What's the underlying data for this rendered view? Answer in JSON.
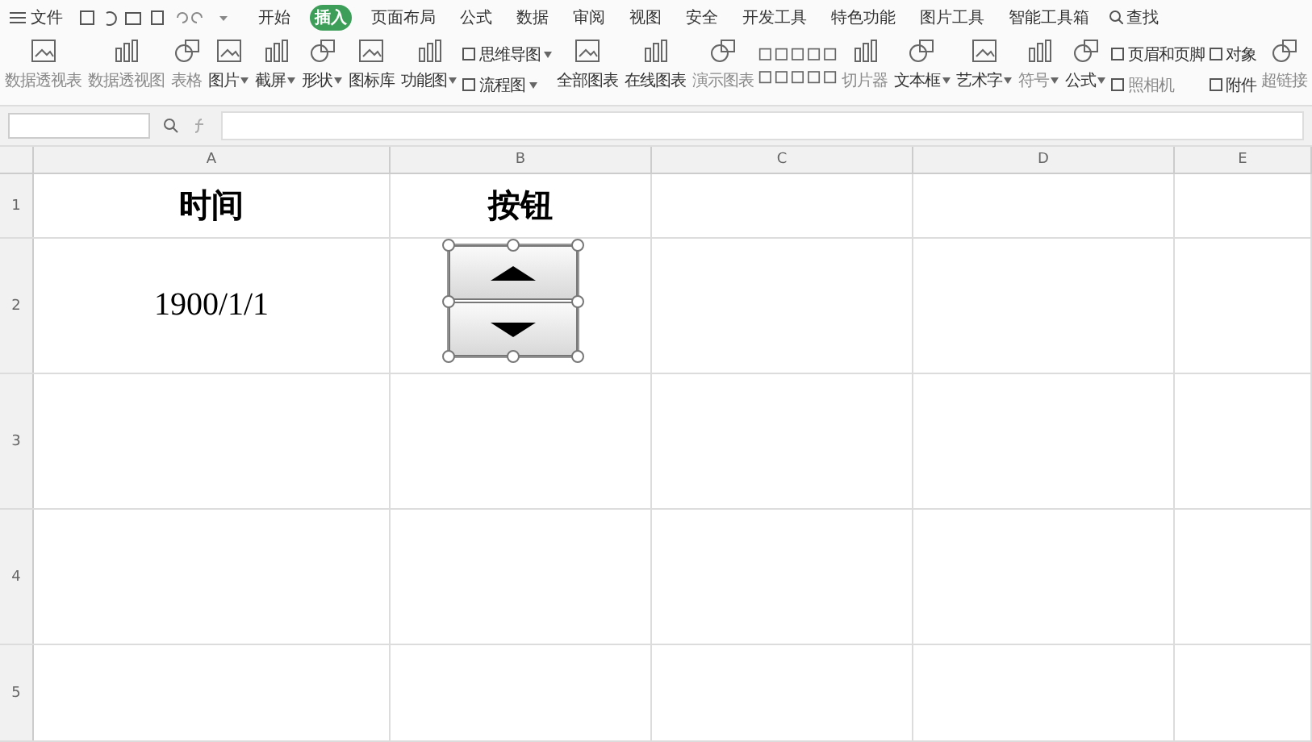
{
  "menu": {
    "file": "文件",
    "tabs": [
      {
        "label": "开始",
        "selected": false
      },
      {
        "label": "插入",
        "selected": true
      },
      {
        "label": "页面布局",
        "selected": false
      },
      {
        "label": "公式",
        "selected": false
      },
      {
        "label": "数据",
        "selected": false
      },
      {
        "label": "审阅",
        "selected": false
      },
      {
        "label": "视图",
        "selected": false
      },
      {
        "label": "安全",
        "selected": false
      },
      {
        "label": "开发工具",
        "selected": false
      },
      {
        "label": "特色功能",
        "selected": false
      },
      {
        "label": "图片工具",
        "selected": false
      },
      {
        "label": "智能工具箱",
        "selected": false
      }
    ],
    "search": "查找"
  },
  "ribbon": [
    {
      "kind": "large",
      "label": "数据透视表",
      "disabled": true,
      "dropdown": false
    },
    {
      "kind": "large",
      "label": "数据透视图",
      "disabled": true,
      "dropdown": false
    },
    {
      "kind": "large",
      "label": "表格",
      "disabled": true,
      "dropdown": false
    },
    {
      "kind": "large",
      "label": "图片",
      "disabled": false,
      "dropdown": true
    },
    {
      "kind": "large",
      "label": "截屏",
      "disabled": false,
      "dropdown": true
    },
    {
      "kind": "large",
      "label": "形状",
      "disabled": false,
      "dropdown": true
    },
    {
      "kind": "large",
      "label": "图标库",
      "disabled": false,
      "dropdown": false
    },
    {
      "kind": "large",
      "label": "功能图",
      "disabled": false,
      "dropdown": true
    },
    {
      "kind": "pair",
      "items": [
        {
          "label": "思维导图",
          "disabled": false,
          "dropdown": true
        },
        {
          "label": "流程图",
          "disabled": false,
          "dropdown": true
        }
      ]
    },
    {
      "kind": "large",
      "label": "全部图表",
      "disabled": false,
      "dropdown": false
    },
    {
      "kind": "large",
      "label": "在线图表",
      "disabled": false,
      "dropdown": false
    },
    {
      "kind": "large",
      "label": "演示图表",
      "disabled": true,
      "dropdown": false
    },
    {
      "kind": "charts"
    },
    {
      "kind": "large",
      "label": "切片器",
      "disabled": true,
      "dropdown": false
    },
    {
      "kind": "large",
      "label": "文本框",
      "disabled": false,
      "dropdown": true
    },
    {
      "kind": "large",
      "label": "艺术字",
      "disabled": false,
      "dropdown": true
    },
    {
      "kind": "large",
      "label": "符号",
      "disabled": true,
      "dropdown": true
    },
    {
      "kind": "large",
      "label": "公式",
      "disabled": false,
      "dropdown": true
    },
    {
      "kind": "pair",
      "items": [
        {
          "label": "页眉和页脚",
          "disabled": false,
          "dropdown": false
        },
        {
          "label": "照相机",
          "disabled": true,
          "dropdown": false
        }
      ]
    },
    {
      "kind": "pair",
      "items": [
        {
          "label": "对象",
          "disabled": false,
          "dropdown": false
        },
        {
          "label": "附件",
          "disabled": false,
          "dropdown": false
        }
      ]
    },
    {
      "kind": "large",
      "label": "超链接",
      "disabled": true,
      "dropdown": false
    }
  ],
  "sheet": {
    "columns": [
      "A",
      "B",
      "C",
      "D",
      "E"
    ],
    "rows": [
      {
        "number": "1",
        "cells": [
          "时间",
          "按钮",
          "",
          ""
        ]
      },
      {
        "number": "2",
        "cells": [
          "1900/1/1",
          "",
          "",
          ""
        ]
      },
      {
        "number": "3",
        "cells": [
          "",
          "",
          "",
          ""
        ]
      },
      {
        "number": "4",
        "cells": [
          "",
          "",
          "",
          ""
        ]
      },
      {
        "number": "5",
        "cells": [
          "",
          "",
          "",
          ""
        ]
      }
    ],
    "spin_button": {
      "selected": true
    }
  }
}
